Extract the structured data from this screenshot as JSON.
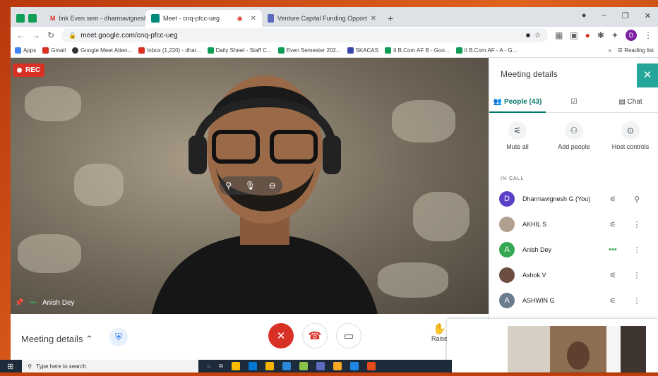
{
  "tabs": [
    {
      "label": "link Even sem - dharmavigneshg"
    },
    {
      "label": "Meet - cnq-pfcc-ueg"
    },
    {
      "label": "Venture Capital Funding Opport"
    }
  ],
  "window_controls": {
    "minimize": "−",
    "maximize": "❐",
    "close": "✕"
  },
  "address": {
    "url": "meet.google.com/cnq-pfcc-ueg",
    "profile_initial": "D"
  },
  "bookmarks": [
    "Apps",
    "Gmail",
    "Google Meet Atten...",
    "Inbox (1,220) - dhar...",
    "Daily Sheet - Staff C...",
    "Even Semester 202...",
    "SKACAS",
    "II B.Com AF B - Goo...",
    "II B.Com AF - A - G..."
  ],
  "reading_list": "Reading list",
  "video": {
    "rec": "REC",
    "speaker": "Anish Dey"
  },
  "bottom": {
    "meeting_details": "Meeting details",
    "raise": "Raise"
  },
  "panel": {
    "title": "Meeting details",
    "tabs": {
      "people": "People (43)",
      "chat": "Chat"
    },
    "actions": [
      "Mute all",
      "Add people",
      "Host controls"
    ],
    "in_call": "IN CALL",
    "participants": [
      {
        "initial": "D",
        "name": "Dharmavignesh G (You)",
        "color": "#5b3fc8"
      },
      {
        "initial": "",
        "name": "AKHIL S",
        "color": "#b0a090"
      },
      {
        "initial": "A",
        "name": "Anish Dey",
        "color": "#34a853"
      },
      {
        "initial": "",
        "name": "Ashok V",
        "color": "#6d4c41"
      },
      {
        "initial": "A",
        "name": "ASHWIN G",
        "color": "#6a7b8c"
      }
    ]
  },
  "taskbar": {
    "search": "Type here to search"
  },
  "colors": {
    "accent": "#00796b",
    "end_call": "#d93025",
    "frame": "#c2410c"
  }
}
